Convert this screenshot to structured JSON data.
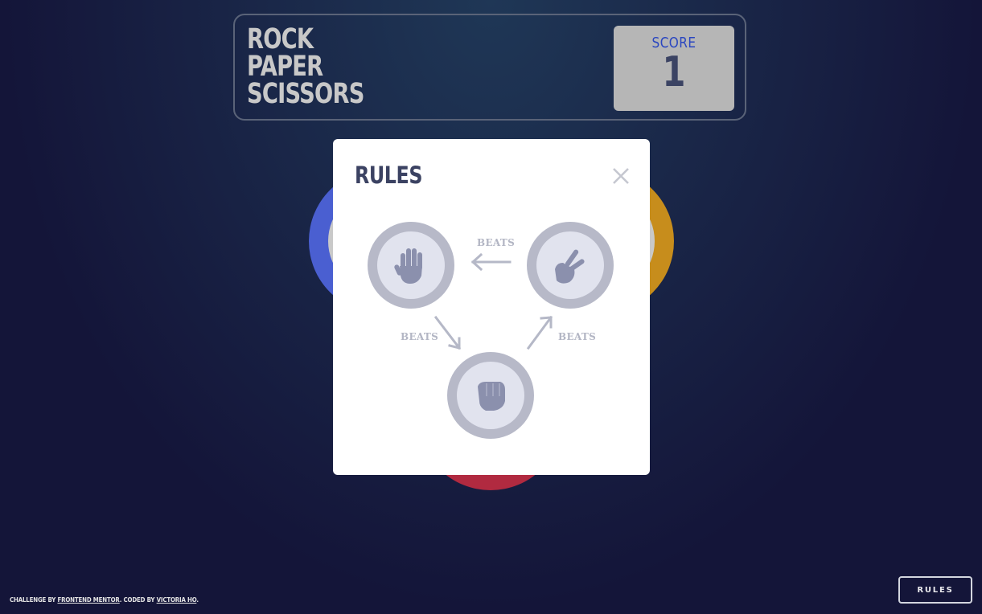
{
  "header": {
    "title_lines": [
      "ROCK",
      "PAPER",
      "SCISSORS"
    ],
    "score_label": "SCORE",
    "score_value": "1"
  },
  "modal": {
    "title": "RULES",
    "close_icon": "close-icon",
    "beats_top": "BEATS",
    "beats_left": "BEATS",
    "beats_right": "BEATS",
    "items": [
      {
        "name": "paper",
        "icon": "hand-paper-icon"
      },
      {
        "name": "scissors",
        "icon": "hand-scissors-icon"
      },
      {
        "name": "rock",
        "icon": "hand-rock-icon"
      }
    ]
  },
  "footer": {
    "prefix": "CHALLENGE BY ",
    "link1": "FRONTEND MENTOR",
    "middle": ". CODED BY ",
    "link2": "VICTORIA HO",
    "suffix": "."
  },
  "rules_button": "RULES",
  "colors": {
    "background": "#141539",
    "paper": "#4a5fd1",
    "scissors": "#c78d1c",
    "rock": "#b12a40",
    "score_label": "#2a46c0",
    "dark_text": "#3b4262"
  }
}
